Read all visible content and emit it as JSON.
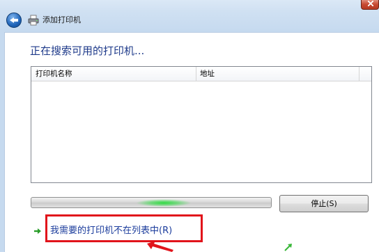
{
  "window": {
    "title": "添加打印机"
  },
  "main": {
    "heading": "正在搜索可用的打印机...",
    "list": {
      "columns": [
        "打印机名称",
        "地址"
      ],
      "rows": []
    },
    "progress": {
      "state": "marquee"
    },
    "stop_button": {
      "label": "停止(S)"
    },
    "not_listed_link": {
      "label": "我需要的打印机不在列表中(R)"
    }
  },
  "colors": {
    "heading": "#1e3a8a",
    "link": "#1b3c9c",
    "highlight_box": "#e1141b",
    "progress_glow": "#28dc3c"
  }
}
